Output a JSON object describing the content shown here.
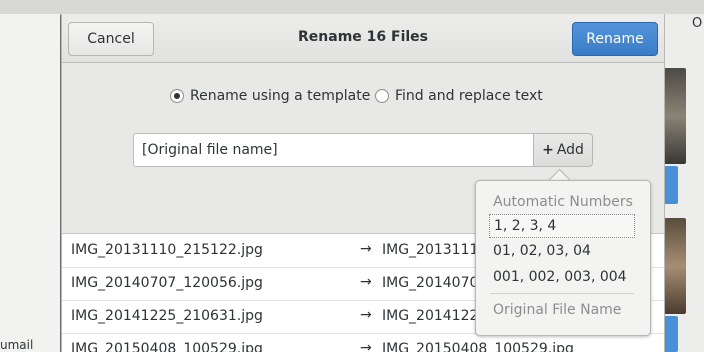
{
  "background": {
    "title_tail": "O",
    "side_text": "umail"
  },
  "dialog": {
    "title": "Rename 16 Files",
    "cancel_label": "Cancel",
    "rename_label": "Rename"
  },
  "mode": {
    "option_template": "Rename using a template",
    "option_replace": "Find and replace text",
    "selected": "template"
  },
  "template": {
    "value": "[Original file name]",
    "add_label": "Add"
  },
  "files": [
    {
      "from": "IMG_20131110_215122.jpg",
      "to": "IMG_20131110"
    },
    {
      "from": "IMG_20140707_120056.jpg",
      "to": "IMG_20140707"
    },
    {
      "from": "IMG_20141225_210631.jpg",
      "to": "IMG_20141225"
    },
    {
      "from": "IMG_20150408_100529.jpg",
      "to": "IMG_20150408_100529.jpg"
    }
  ],
  "popover": {
    "section_title": "Automatic Numbers",
    "items": [
      "1, 2, 3, 4",
      "01, 02, 03, 04",
      "001, 002, 003, 004"
    ],
    "selected_index": 0,
    "footer": "Original File Name"
  },
  "colors": {
    "accent": "#3a7cc6",
    "dialog_bg": "#e8e8e7"
  }
}
